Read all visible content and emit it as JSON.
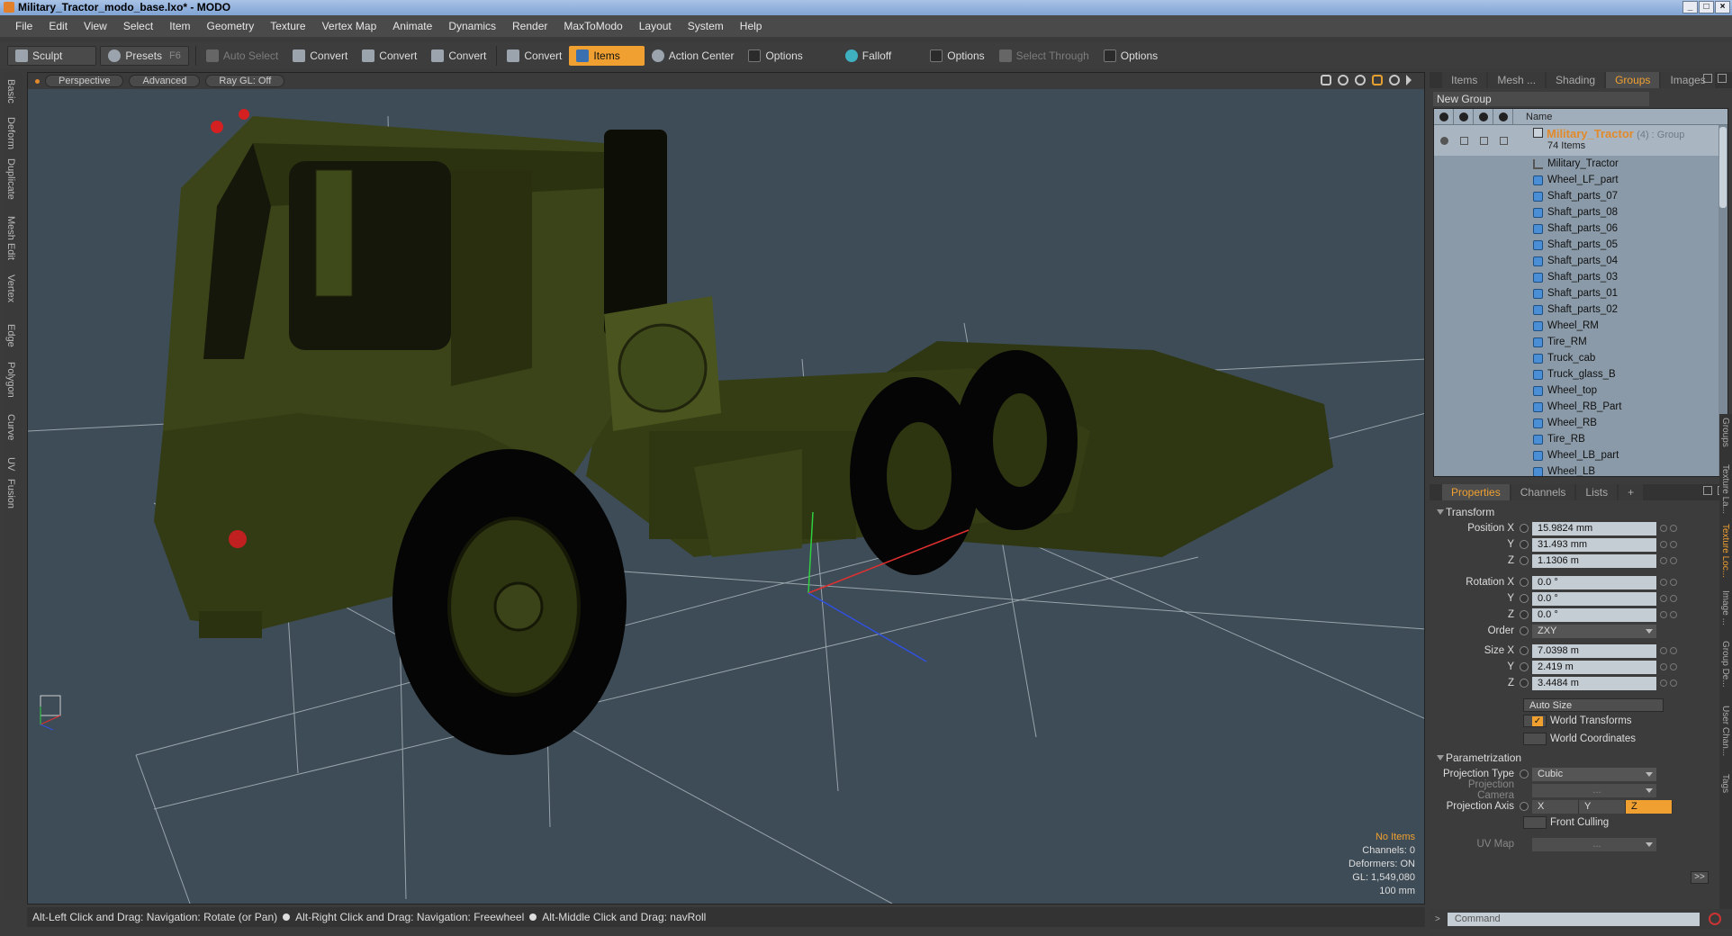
{
  "window": {
    "title": "Military_Tractor_modo_base.lxo* - MODO",
    "buttons": [
      "_",
      "□",
      "×"
    ]
  },
  "menu": [
    "File",
    "Edit",
    "View",
    "Select",
    "Item",
    "Geometry",
    "Texture",
    "Vertex Map",
    "Animate",
    "Dynamics",
    "Render",
    "MaxToModo",
    "Layout",
    "System",
    "Help"
  ],
  "toolbar": {
    "sculpt": "Sculpt",
    "presets": "Presets",
    "presets_key": "F6",
    "auto_select": "Auto Select",
    "convert": "Convert",
    "items": "Items",
    "action_center": "Action Center",
    "options": "Options",
    "falloff": "Falloff",
    "select_through": "Select Through"
  },
  "left_tabs": [
    "Basic",
    "Deform",
    "Duplicate",
    "Mesh Edit",
    "Vertex",
    "Edge",
    "Polygon",
    "Curve",
    "UV",
    "Fusion"
  ],
  "viewport": {
    "view": "Perspective",
    "shading": "Advanced",
    "raygl": "Ray GL: Off",
    "info": {
      "items": "No Items",
      "channels": "Channels: 0",
      "deformers": "Deformers: ON",
      "gl": "GL: 1,549,080",
      "scale": "100 mm"
    }
  },
  "status": {
    "tips": [
      "Alt-Left Click and Drag: Navigation: Rotate (or Pan)",
      "Alt-Right Click and Drag: Navigation: Freewheel",
      "Alt-Middle Click and Drag: navRoll"
    ]
  },
  "panel": {
    "tabs": [
      "Items",
      "Mesh ...",
      "Shading",
      "Groups",
      "Images"
    ],
    "new_group": "New Group",
    "name_col": "Name",
    "group": {
      "name": "Military_Tractor",
      "suffix": "(4) : Group",
      "count": "74 Items"
    },
    "items": [
      "Military_Tractor",
      "Wheel_LF_part",
      "Shaft_parts_07",
      "Shaft_parts_08",
      "Shaft_parts_06",
      "Shaft_parts_05",
      "Shaft_parts_04",
      "Shaft_parts_03",
      "Shaft_parts_01",
      "Shaft_parts_02",
      "Wheel_RM",
      "Tire_RM",
      "Truck_cab",
      "Truck_glass_B",
      "Wheel_top",
      "Wheel_RB_Part",
      "Wheel_RB",
      "Tire_RB",
      "Wheel_LB_part",
      "Wheel_LB"
    ]
  },
  "props": {
    "tabs": [
      "Properties",
      "Channels",
      "Lists",
      "+"
    ],
    "transform": "Transform",
    "position_label": "Position X",
    "position": [
      "15.9824 mm",
      "31.493 mm",
      "1.1306 m"
    ],
    "rotation_label": "Rotation X",
    "rotation": [
      "0.0 °",
      "0.0 °",
      "0.0 °"
    ],
    "order_label": "Order",
    "order": "ZXY",
    "size_label": "Size X",
    "size": [
      "7.0398 m",
      "2.419 m",
      "3.4484 m"
    ],
    "y": "Y",
    "z": "Z",
    "auto_size": "Auto Size",
    "world_transforms": "World Transforms",
    "world_coordinates": "World Coordinates",
    "parametrization": "Parametrization",
    "projection_type_label": "Projection Type",
    "projection_type": "Cubic",
    "projection_camera_label": "Projection Camera",
    "projection_camera": "...",
    "projection_axis_label": "Projection Axis",
    "axes": [
      "X",
      "Y",
      "Z"
    ],
    "front_culling": "Front Culling",
    "uv_map_label": "UV Map",
    "uv_map": "...",
    "more": ">>"
  },
  "right_vtabs": [
    "Groups",
    "Texture La...",
    "Texture Loc...",
    "Image ...",
    "Group De...",
    "User Chan...",
    "Tags"
  ],
  "command": {
    "placeholder": "Command"
  },
  "colors": {
    "accent": "#f0a030",
    "viewport_bg": "#3e4c57",
    "truck": "#3b4418"
  }
}
